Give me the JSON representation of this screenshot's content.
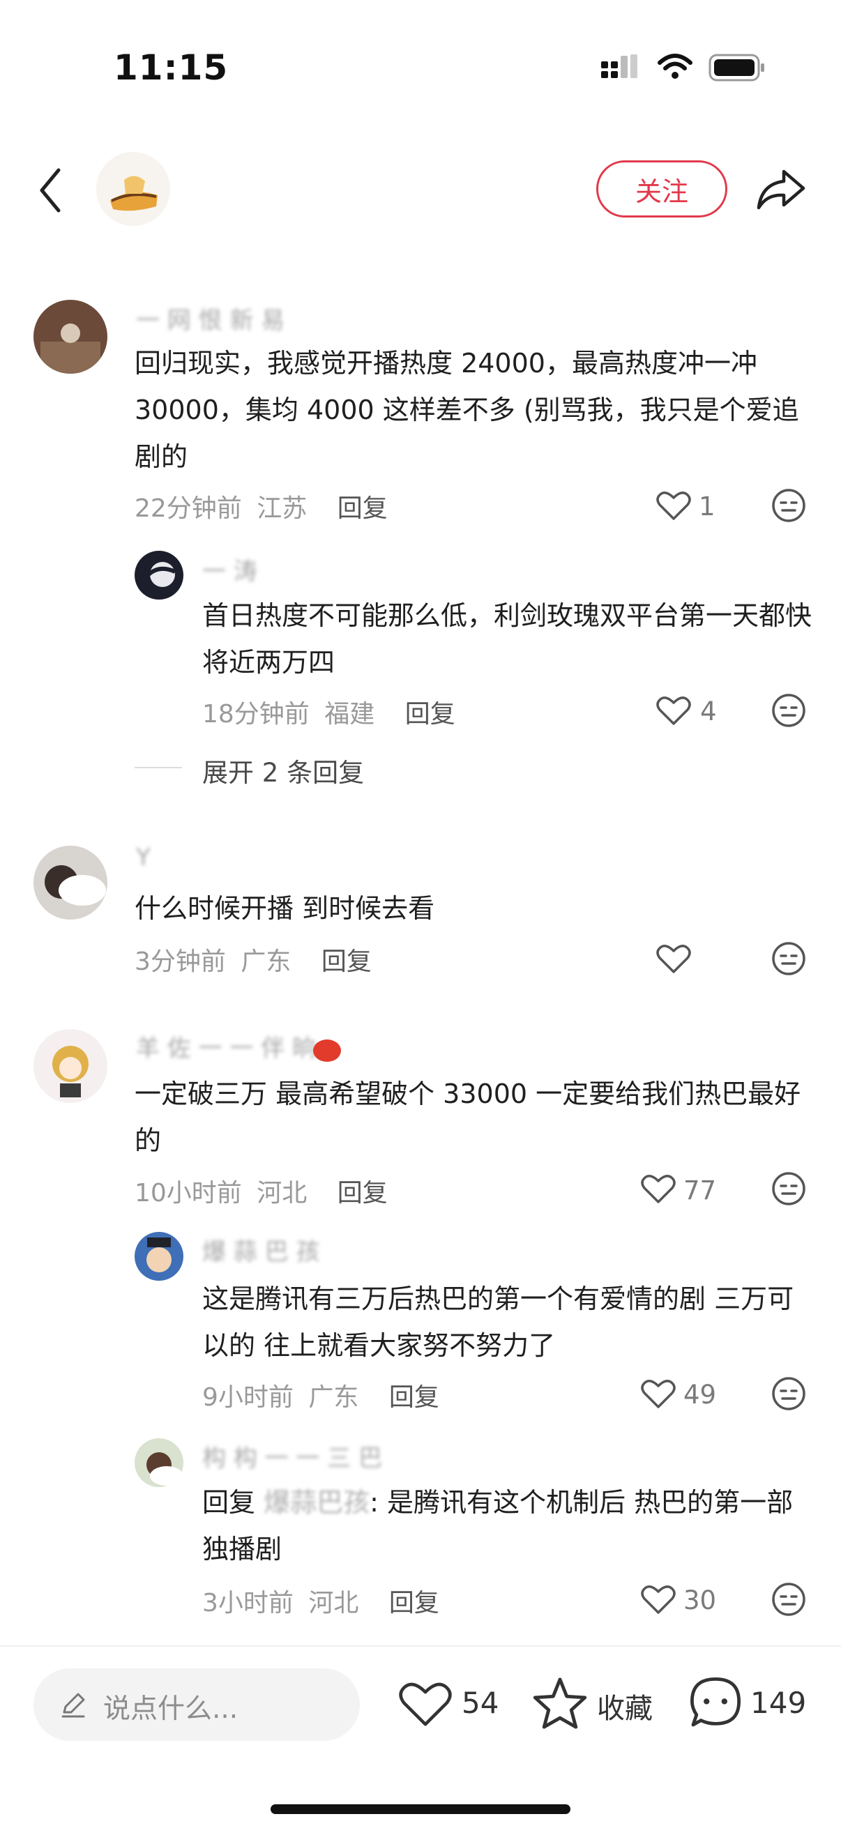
{
  "status_bar": {
    "time": "11:15"
  },
  "header": {
    "follow_label": "关注"
  },
  "comments": [
    {
      "name": "一 网 恨 新 易",
      "text": "回归现实，我感觉开播热度 24000，最高热度冲一冲 30000，集均 4000 这样差不多 (别骂我，我只是个爱追剧的",
      "time": "22分钟前",
      "location": "江苏",
      "reply_label": "回复",
      "likes": "1",
      "replies": [
        {
          "name": "一 涛",
          "text": "首日热度不可能那么低，利剑玫瑰双平台第一天都快将近两万四",
          "time": "18分钟前",
          "location": "福建",
          "reply_label": "回复",
          "likes": "4"
        }
      ],
      "expand_label": "展开 2 条回复"
    },
    {
      "name": "Y",
      "text": "什么时候开播 到时候去看",
      "time": "3分钟前",
      "location": "广东",
      "reply_label": "回复",
      "likes": ""
    },
    {
      "name": "羊 佐 一 一 伴 晌",
      "text": "一定破三万 最高希望破个 33000 一定要给我们热巴最好的",
      "time": "10小时前",
      "location": "河北",
      "reply_label": "回复",
      "likes": "77",
      "replies": [
        {
          "name": "爆 蒜 巴 孩",
          "text": "这是腾讯有三万后热巴的第一个有爱情的剧 三万可以的 往上就看大家努不努力了",
          "time": "9小时前",
          "location": "广东",
          "reply_label": "回复",
          "likes": "49"
        },
        {
          "name": "构 构 一 一 三 巴",
          "text_prefix": "回复",
          "text_mention": "爆蒜巴孩",
          "text": ": 是腾讯有这个机制后 热巴的第一部独播剧",
          "time": "3小时前",
          "location": "河北",
          "reply_label": "回复",
          "likes": "30"
        }
      ]
    }
  ],
  "bottom_bar": {
    "input_placeholder": "说点什么...",
    "likes": "54",
    "favorite_label": "收藏",
    "comments": "149"
  },
  "colors": {
    "accent": "#e2394a",
    "muted": "#999999"
  },
  "icons": [
    "back-icon",
    "share-icon",
    "heart-icon",
    "face-icon",
    "pencil-icon",
    "star-icon",
    "comment-icon",
    "signal-icon",
    "wifi-icon",
    "battery-icon"
  ]
}
